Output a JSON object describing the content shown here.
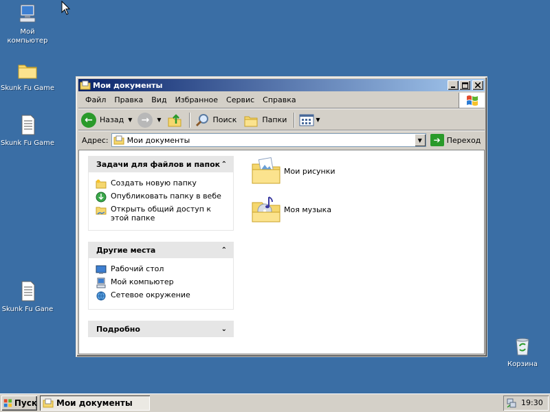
{
  "desktop": {
    "icons": [
      {
        "label": "Мой компьютер",
        "icon": "my-computer-icon"
      },
      {
        "label": "Skunk Fu Game",
        "icon": "folder-icon"
      },
      {
        "label": "Skunk Fu Game",
        "icon": "text-file-icon"
      },
      {
        "label": "Skunk Fu Gane",
        "icon": "text-file-icon"
      },
      {
        "label": "Корзина",
        "icon": "recycle-bin-icon"
      }
    ]
  },
  "window": {
    "title": "Мои документы",
    "menu": [
      "Файл",
      "Правка",
      "Вид",
      "Избранное",
      "Сервис",
      "Справка"
    ],
    "toolbar": {
      "back": "Назад",
      "search": "Поиск",
      "folders": "Папки"
    },
    "address": {
      "label": "Адрес:",
      "value": "Мои документы",
      "go": "Переход"
    },
    "task_panels": [
      {
        "title": "Задачи для файлов и папок",
        "expanded": true,
        "items": [
          "Создать новую папку",
          "Опубликовать папку в вебе",
          "Открыть общий доступ к этой папке"
        ]
      },
      {
        "title": "Другие места",
        "expanded": true,
        "items": [
          "Рабочий стол",
          "Мой компьютер",
          "Сетевое окружение"
        ]
      },
      {
        "title": "Подробно",
        "expanded": false,
        "items": []
      }
    ],
    "files": [
      {
        "name": "Мои рисунки",
        "icon": "pictures-folder-icon"
      },
      {
        "name": "Моя музыка",
        "icon": "music-folder-icon"
      }
    ]
  },
  "taskbar": {
    "start": "Пуск",
    "task": "Мои документы",
    "time": "19:30"
  }
}
